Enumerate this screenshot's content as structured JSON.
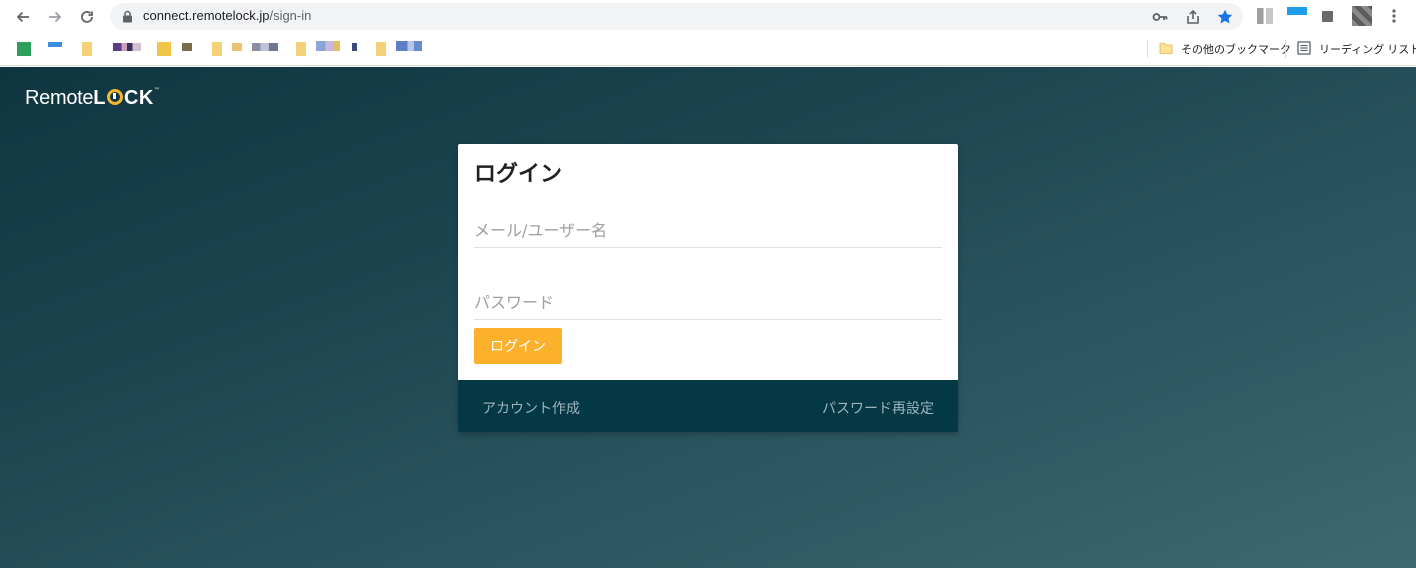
{
  "browser": {
    "url_host": "connect.remotelock.jp",
    "url_path": "/sign-in",
    "bookmarks_right": [
      {
        "label": "その他のブックマーク"
      },
      {
        "label": "リーディング リスト"
      }
    ]
  },
  "page": {
    "logo_remote": "Remote",
    "logo_l": "L",
    "logo_ck": "CK",
    "logo_tm": "™"
  },
  "login": {
    "title": "ログイン",
    "email_placeholder": "メール/ユーザー名",
    "email_value": "",
    "password_placeholder": "パスワード",
    "password_value": "",
    "submit_label": "ログイン",
    "create_account": "アカウント作成",
    "reset_password": "パスワード再設定"
  },
  "colors": {
    "accent": "#fbb12b",
    "footer": "#053845",
    "bg_dark": "#0e3540",
    "bg_light": "#3d6970"
  },
  "icons": {
    "back": "arrow-left-icon",
    "forward": "arrow-right-icon",
    "reload": "reload-icon",
    "lock": "lock-icon",
    "key": "key-icon",
    "share": "share-icon",
    "star": "star-icon",
    "menu": "kebab-menu-icon",
    "folder": "folder-icon",
    "reading_list": "reading-list-icon"
  }
}
